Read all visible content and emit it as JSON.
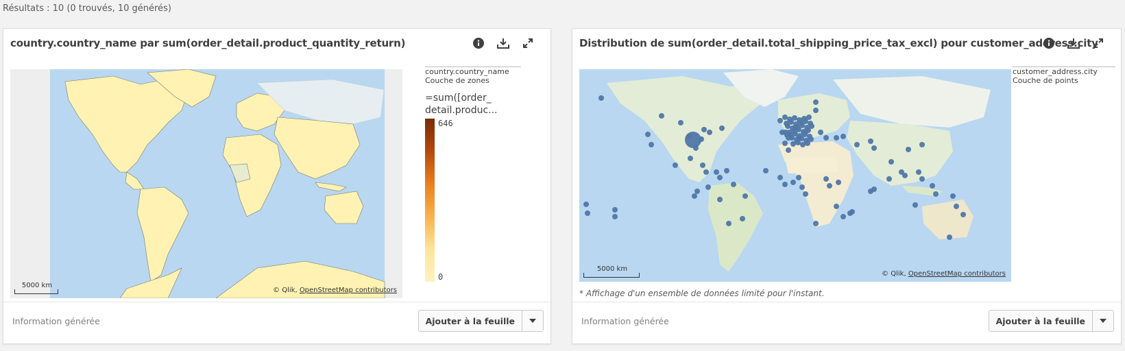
{
  "results_text": "Résultats : 10 (0 trouvés, 10 générés)",
  "cards": [
    {
      "title": "country.country_name par sum(order_detail.product_quantity_return)",
      "legend": {
        "dimension": "country.country_name",
        "layer": "Couche de zones",
        "measure_line1": "=sum([order_",
        "measure_line2": "detail.produc...",
        "max": "646",
        "min": "0"
      },
      "scale_label": "5000 km",
      "attribution_prefix": "© Qlik,",
      "attribution_link": "OpenStreetMap contributors",
      "footer_label": "Information générée",
      "add_button": "Ajouter à la feuille"
    },
    {
      "title": "Distribution de sum(order_detail.total_shipping_price_tax_excl) pour customer_address.city",
      "legend": {
        "dimension": "customer_address.city",
        "layer": "Couche de points"
      },
      "scale_label": "5000 km",
      "attribution_prefix": "© Qlik,",
      "attribution_link": "OpenStreetMap contributors",
      "note": "* Affichage d'un ensemble de données limité pour l'instant.",
      "footer_label": "Information générée",
      "add_button": "Ajouter à la feuille"
    }
  ],
  "icons": [
    "info-icon",
    "download-icon",
    "expand-icon",
    "chevron-down-icon"
  ],
  "colors": {
    "point": "#4f77a8",
    "area_fill": "#fff2b3",
    "water": "#b9d7f0",
    "gradient_max": "#7a2b06",
    "gradient_min": "#fff2c0"
  }
}
